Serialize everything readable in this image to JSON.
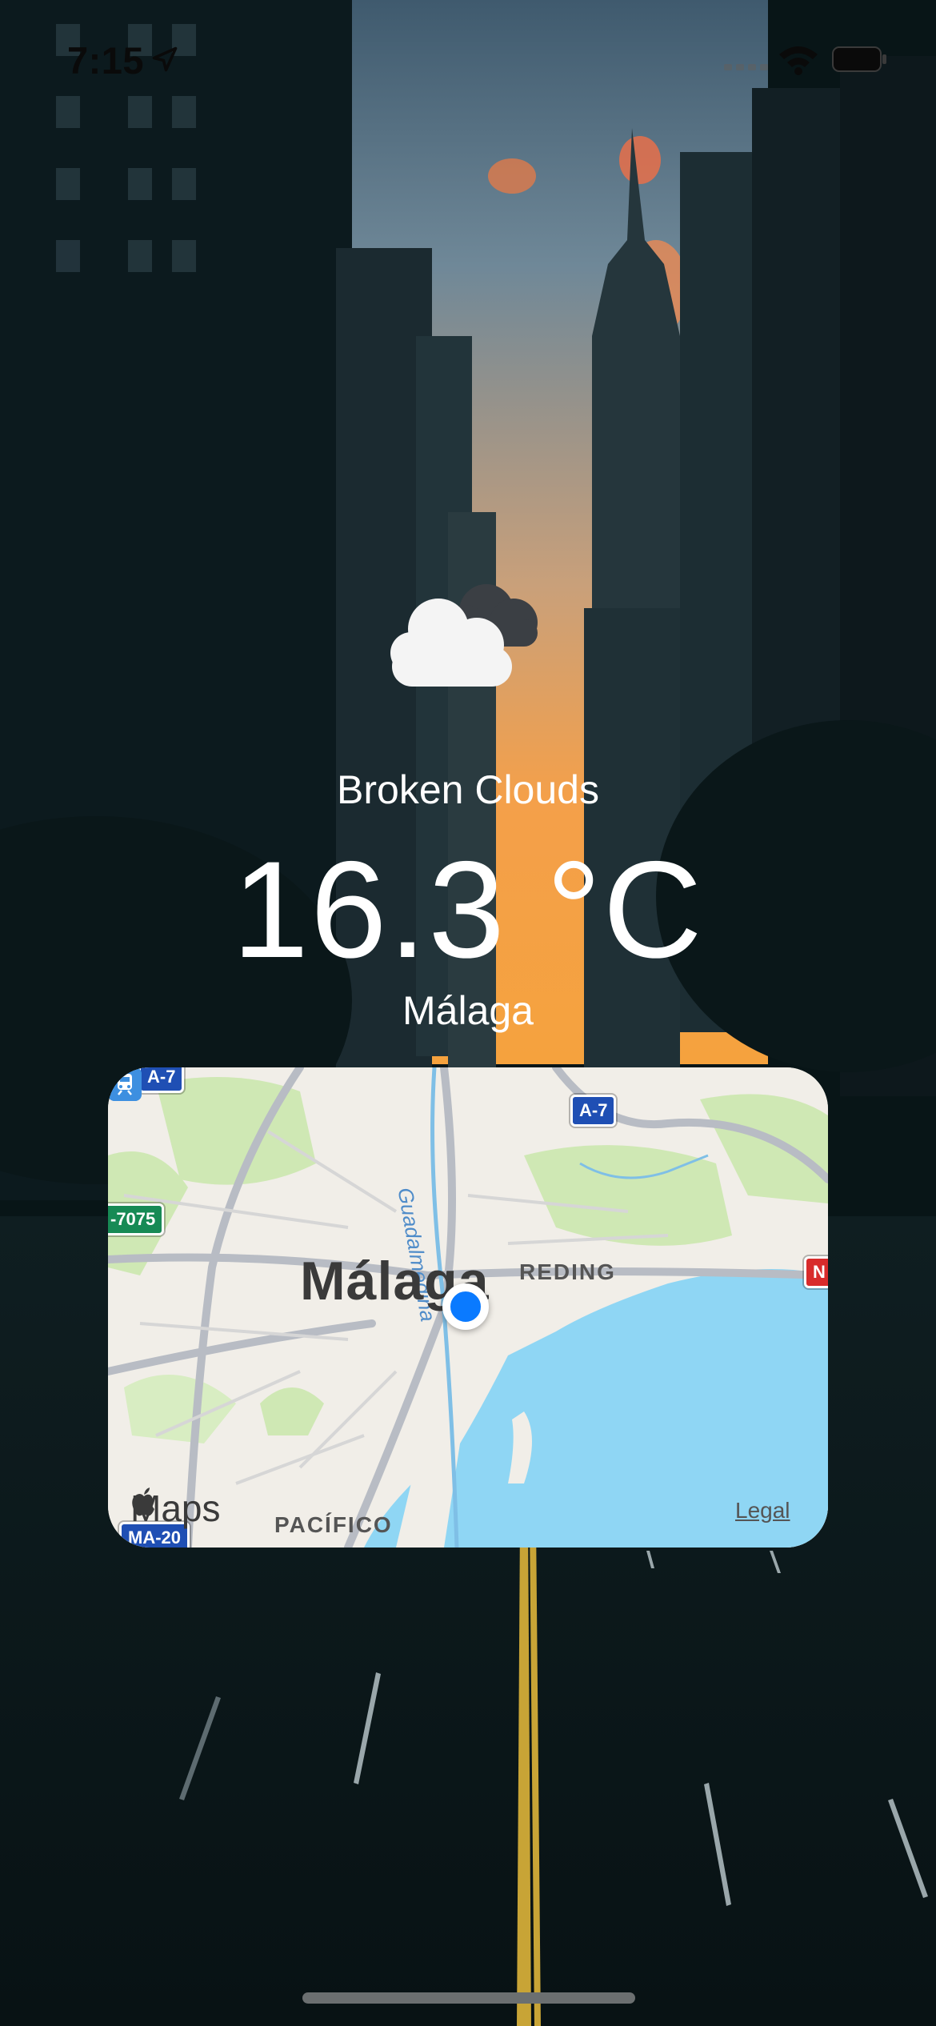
{
  "status_bar": {
    "time": "7:15",
    "location_icon": "location-arrow-icon",
    "signal_icon": "cellular-signal-icon",
    "wifi_icon": "wifi-icon",
    "battery_icon": "battery-icon"
  },
  "weather": {
    "icon": "broken-clouds-icon",
    "condition": "Broken Clouds",
    "temperature": "16.3 °C",
    "city": "Málaga"
  },
  "map": {
    "city_label": "Málaga",
    "district_label": "REDING",
    "south_label": "PACÍFICO",
    "river_label": "Guadalmedina",
    "road_shields": {
      "a7_top": "A-7",
      "a7_corner": "A-7",
      "road_7075": "-7075",
      "n_road": "N",
      "ma20": "MA-20"
    },
    "maps_brand": "Maps",
    "legal": "Legal",
    "colors": {
      "water": "#8fd6f4",
      "park": "#cfe8b4",
      "user_location": "#0a7aff"
    }
  }
}
